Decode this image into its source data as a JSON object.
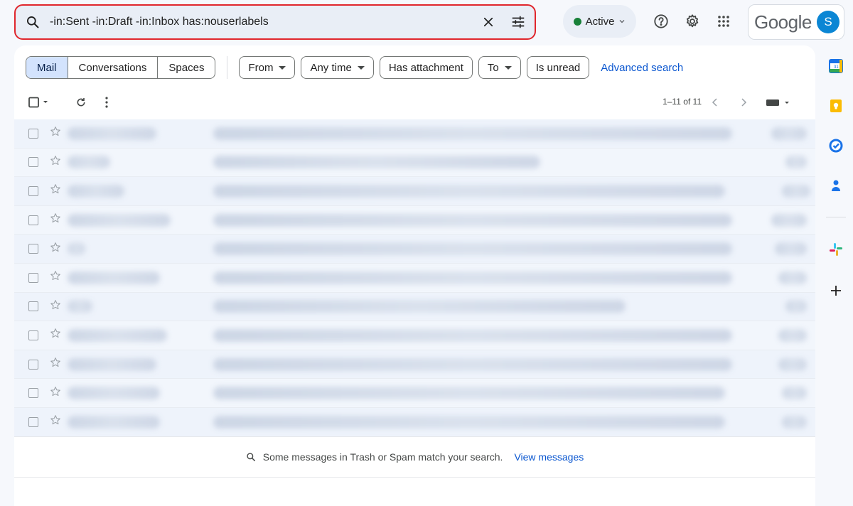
{
  "search": {
    "query": "-in:Sent -in:Draft -in:Inbox has:nouserlabels",
    "icons": [
      "search-icon",
      "clear-icon",
      "search-options-icon"
    ]
  },
  "header": {
    "status_label": "Active",
    "brand": "Google",
    "avatar_letter": "S",
    "icons": [
      "help-icon",
      "settings-icon",
      "apps-grid-icon"
    ],
    "colors": {
      "status_dot": "#188038",
      "avatar": "#0b86d4",
      "highlight_border": "#e0262c"
    }
  },
  "filters": {
    "tabs": [
      "Mail",
      "Conversations",
      "Spaces"
    ],
    "selected_tab": "Mail",
    "chips": {
      "from": "From",
      "any_time": "Any time",
      "has_attachment": "Has attachment",
      "to": "To",
      "is_unread": "Is unread"
    },
    "advanced_search": "Advanced search"
  },
  "toolbar": {
    "pagination": "1–11 of 11",
    "icons": [
      "select-checkbox-icon",
      "refresh-icon",
      "more-icon",
      "prev-page-icon",
      "next-page-icon",
      "keyboard-icon"
    ]
  },
  "message_list": {
    "row_count": 11,
    "rows_blurred": true
  },
  "footer": {
    "message": "Some messages in Trash or Spam match your search.",
    "link": "View messages"
  },
  "side_rail": {
    "icons": [
      "calendar-icon",
      "keep-icon",
      "tasks-icon",
      "contacts-icon",
      "slack-icon",
      "add-icon"
    ]
  }
}
